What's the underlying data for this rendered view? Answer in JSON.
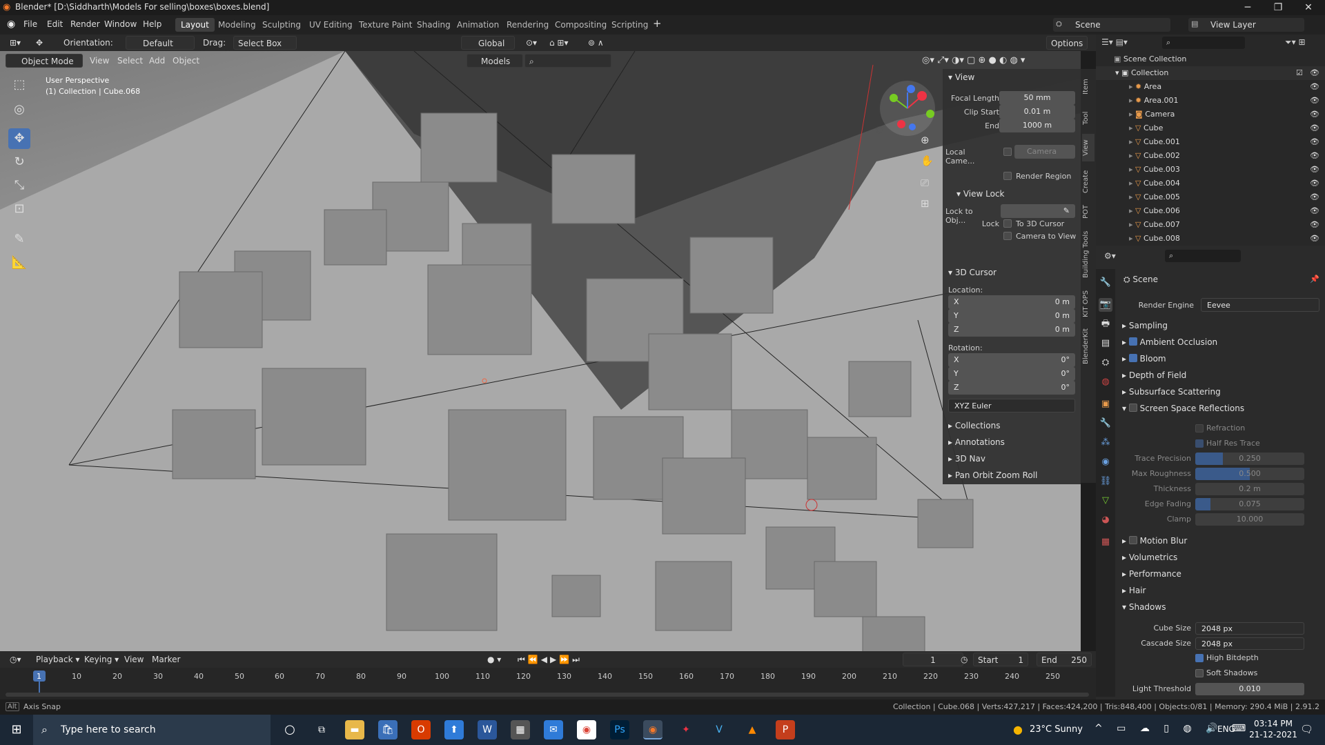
{
  "window": {
    "title": "Blender* [D:\\Siddharth\\Models For selling\\boxes\\boxes.blend]"
  },
  "menu": [
    "File",
    "Edit",
    "Render",
    "Window",
    "Help"
  ],
  "workspaces": [
    "Layout",
    "Modeling",
    "Sculpting",
    "UV Editing",
    "Texture Paint",
    "Shading",
    "Animation",
    "Rendering",
    "Compositing",
    "Scripting"
  ],
  "active_workspace": "Layout",
  "scene": {
    "scene_name": "Scene",
    "view_layer": "View Layer"
  },
  "tool_header": {
    "orientation_label": "Orientation:",
    "orientation": "Default",
    "drag_label": "Drag:",
    "drag": "Select Box",
    "transform": "Global",
    "options": "Options"
  },
  "viewport_header": {
    "mode": "Object Mode",
    "menus": [
      "View",
      "Select",
      "Add",
      "Object"
    ],
    "models": "Models"
  },
  "viewport": {
    "perspective": "User Perspective",
    "collection": "(1) Collection | Cube.068"
  },
  "npanel": {
    "view_header": "View",
    "focal_length_label": "Focal Length",
    "focal_length": "50 mm",
    "clip_start_label": "Clip Start",
    "clip_start": "0.01 m",
    "end_label": "End",
    "end": "1000 m",
    "local_camera_label": "Local Came...",
    "local_camera": "Camera",
    "render_region": "Render Region",
    "view_lock_header": "View Lock",
    "lock_to_obj_label": "Lock to Obj...",
    "lock_label": "Lock",
    "to_3d_cursor": "To 3D Cursor",
    "camera_to_view": "Camera to View",
    "cursor_header": "3D Cursor",
    "location_label": "Location:",
    "loc": [
      {
        "axis": "X",
        "val": "0 m"
      },
      {
        "axis": "Y",
        "val": "0 m"
      },
      {
        "axis": "Z",
        "val": "0 m"
      }
    ],
    "rotation_label": "Rotation:",
    "rot": [
      {
        "axis": "X",
        "val": "0°"
      },
      {
        "axis": "Y",
        "val": "0°"
      },
      {
        "axis": "Z",
        "val": "0°"
      }
    ],
    "rotation_mode": "XYZ Euler",
    "collapsed": [
      "Collections",
      "Annotations",
      "3D Nav",
      "Pan Orbit Zoom Roll"
    ]
  },
  "side_tabs": [
    "Item",
    "Tool",
    "View",
    "Create",
    "POT",
    "Building Tools",
    "KIT OPS",
    "BlenderKit"
  ],
  "outliner": {
    "root": "Scene Collection",
    "collection": "Collection",
    "items": [
      "Area",
      "Area.001",
      "Camera",
      "Cube",
      "Cube.001",
      "Cube.002",
      "Cube.003",
      "Cube.004",
      "Cube.005",
      "Cube.006",
      "Cube.007",
      "Cube.008"
    ]
  },
  "properties": {
    "context": "Scene",
    "render_engine_label": "Render Engine",
    "render_engine": "Eevee",
    "sections": [
      {
        "label": "Sampling",
        "checkbox": false
      },
      {
        "label": "Ambient Occlusion",
        "checkbox": true,
        "checked": true
      },
      {
        "label": "Bloom",
        "checkbox": true,
        "checked": true
      },
      {
        "label": "Depth of Field",
        "checkbox": false
      },
      {
        "label": "Subsurface Scattering",
        "checkbox": false
      },
      {
        "label": "Screen Space Reflections",
        "checkbox": true,
        "checked": false,
        "open": true
      }
    ],
    "ssr": {
      "refraction": "Refraction",
      "half_res_trace": "Half Res Trace",
      "trace_precision_label": "Trace Precision",
      "trace_precision": "0.250",
      "max_roughness_label": "Max Roughness",
      "max_roughness": "0.500",
      "thickness_label": "Thickness",
      "thickness": "0.2 m",
      "edge_fading_label": "Edge Fading",
      "edge_fading": "0.075",
      "clamp_label": "Clamp",
      "clamp": "10.000"
    },
    "sections2": [
      "Motion Blur",
      "Volumetrics",
      "Performance",
      "Hair",
      "Shadows"
    ],
    "shadows": {
      "cube_size_label": "Cube Size",
      "cube_size": "2048 px",
      "cascade_size_label": "Cascade Size",
      "cascade_size": "2048 px",
      "high_bitdepth": "High Bitdepth",
      "soft_shadows": "Soft Shadows",
      "light_threshold_label": "Light Threshold",
      "light_threshold": "0.010"
    }
  },
  "timeline": {
    "menus": [
      "Playback",
      "Keying",
      "View",
      "Marker"
    ],
    "current_frame": "1",
    "start_label": "Start",
    "start": "1",
    "end_label": "End",
    "end": "250",
    "ticks": [
      "1",
      "10",
      "20",
      "30",
      "40",
      "50",
      "60",
      "70",
      "80",
      "90",
      "100",
      "110",
      "120",
      "130",
      "140",
      "150",
      "160",
      "170",
      "180",
      "190",
      "200",
      "210",
      "220",
      "230",
      "240",
      "250"
    ]
  },
  "status": {
    "left": "Axis Snap",
    "right": "Collection | Cube.068 | Verts:427,217 | Faces:424,200 | Tris:848,400 | Objects:0/81 | Memory: 290.4 MiB | 2.91.2"
  },
  "taskbar": {
    "search_placeholder": "Type here to search",
    "weather": "23°C  Sunny",
    "lang": "ENG",
    "time": "03:14 PM",
    "date": "21-12-2021"
  }
}
